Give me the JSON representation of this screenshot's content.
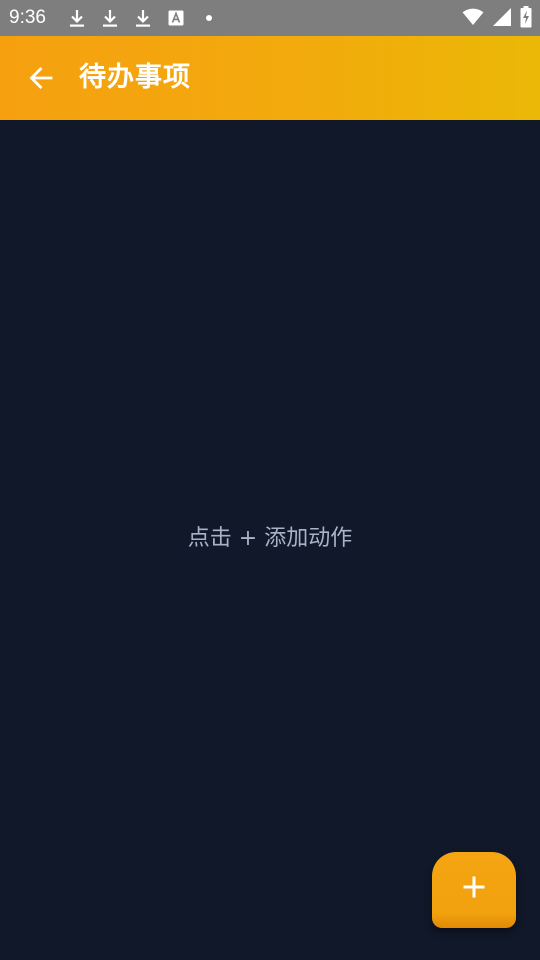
{
  "status_bar": {
    "time": "9:36",
    "left_icons": [
      "download-icon",
      "download-icon",
      "download-icon",
      "font-a-icon",
      "dot-icon"
    ],
    "right_icons": [
      "wifi-icon",
      "cell-signal-icon",
      "battery-charging-icon"
    ]
  },
  "app_bar": {
    "title": "待办事项",
    "back_icon": "arrow-left-icon",
    "colors": {
      "gradient_start": "#f6a010",
      "gradient_end": "#ebb807"
    }
  },
  "main": {
    "empty_hint": "点击 + 添加动作",
    "background": "#11182a"
  },
  "fab": {
    "icon": "plus-icon",
    "color": "#f5a412"
  }
}
